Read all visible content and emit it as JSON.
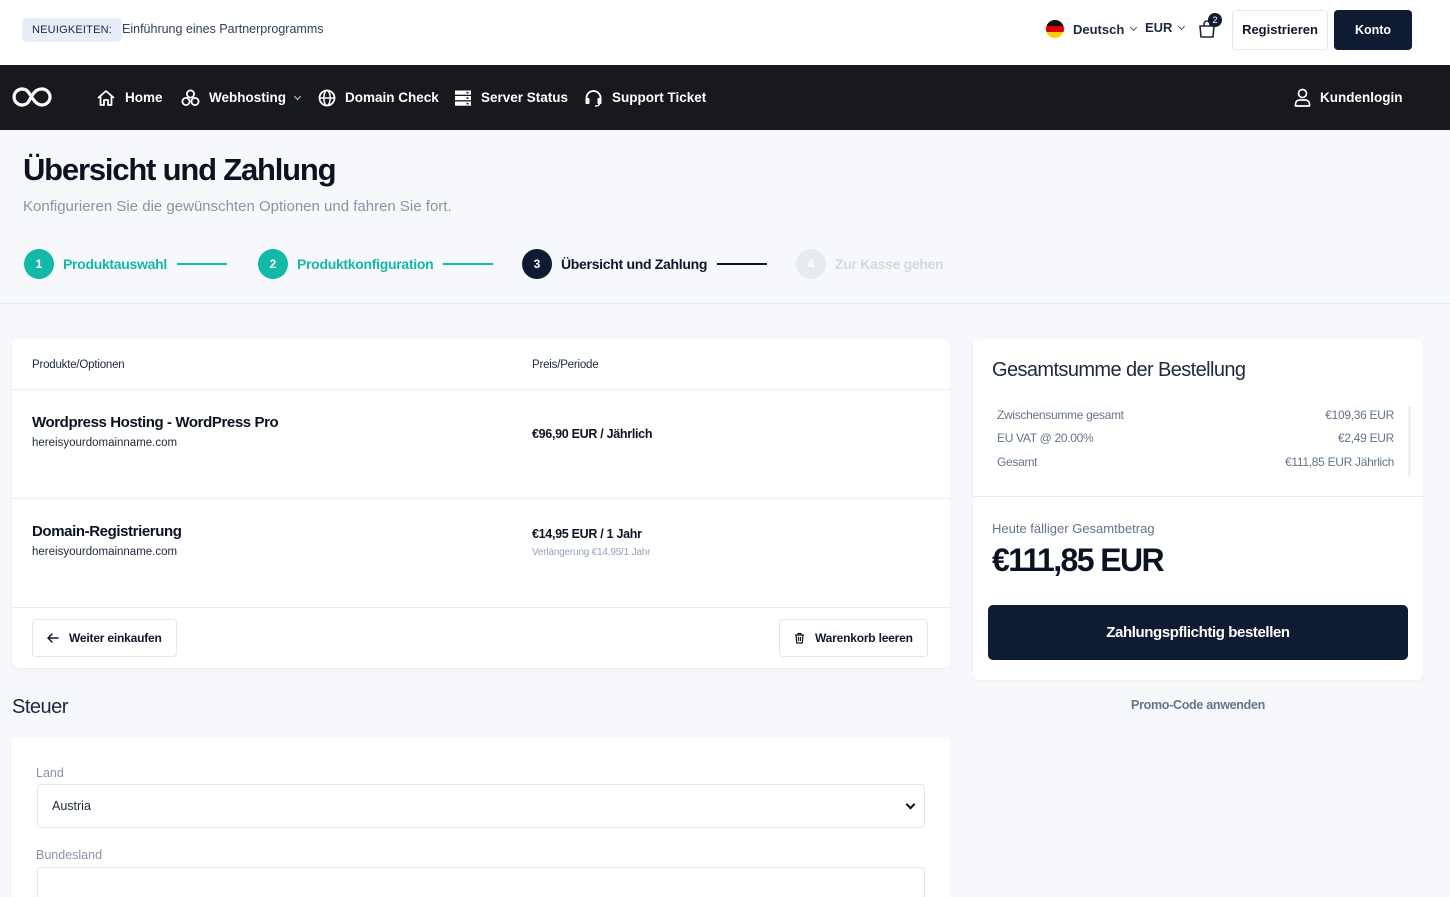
{
  "topbar": {
    "news_badge": "NEUIGKEITEN:",
    "news_text": "Einführung eines Partnerprogramms",
    "language": "Deutsch",
    "currency": "EUR",
    "cart_count": "2",
    "register_label": "Registrieren",
    "account_label": "Konto"
  },
  "nav": {
    "items": [
      {
        "label": "Home",
        "icon": "home-icon"
      },
      {
        "label": "Webhosting",
        "icon": "cubes-icon"
      },
      {
        "label": "Domain Check",
        "icon": "globe-icon"
      },
      {
        "label": "Server Status",
        "icon": "server-icon"
      },
      {
        "label": "Support Ticket",
        "icon": "headset-icon"
      }
    ],
    "login_label": "Kundenlogin"
  },
  "header": {
    "title": "Übersicht und Zahlung",
    "subtitle": "Konfigurieren Sie die gewünschten Optionen und fahren Sie fort."
  },
  "steps": [
    {
      "num": "1",
      "label": "Produktauswahl",
      "state": "done"
    },
    {
      "num": "2",
      "label": "Produktkonfiguration",
      "state": "done"
    },
    {
      "num": "3",
      "label": "Übersicht und Zahlung",
      "state": "current"
    },
    {
      "num": "4",
      "label": "Zur Kasse gehen",
      "state": "todo"
    }
  ],
  "cart": {
    "col_products": "Produkte/Optionen",
    "col_price": "Preis/Periode",
    "items": [
      {
        "name": "Wordpress Hosting - WordPress Pro",
        "domain": "hereisyourdomainname.com",
        "price": "€96,90 EUR / Jährlich",
        "renewal": ""
      },
      {
        "name": "Domain-Registrierung",
        "domain": "hereisyourdomainname.com",
        "price": "€14,95 EUR / 1 Jahr",
        "renewal": "Verlängerung €14,95/1 Jahr"
      }
    ],
    "continue_label": "Weiter einkaufen",
    "empty_label": "Warenkorb leeren"
  },
  "tax": {
    "title": "Steuer",
    "country_label": "Land",
    "country_value": "Austria",
    "state_label": "Bundesland",
    "state_value": ""
  },
  "summary": {
    "title": "Gesamtsumme der Bestellung",
    "rows": [
      {
        "label": "Zwischensumme gesamt",
        "value": "€109,36 EUR"
      },
      {
        "label": "EU VAT @ 20.00%",
        "value": "€2,49 EUR"
      },
      {
        "label": "Gesamt",
        "value": "€111,85 EUR Jährlich"
      }
    ],
    "due_label": "Heute fälliger Gesamtbetrag",
    "due_amount": "€111,85 EUR",
    "order_label": "Zahlungspflichtig bestellen",
    "promo_label": "Promo-Code anwenden"
  },
  "colors": {
    "accent_teal": "#14b8a6",
    "navy": "#0f1b33",
    "nav_bg": "#17191c"
  }
}
